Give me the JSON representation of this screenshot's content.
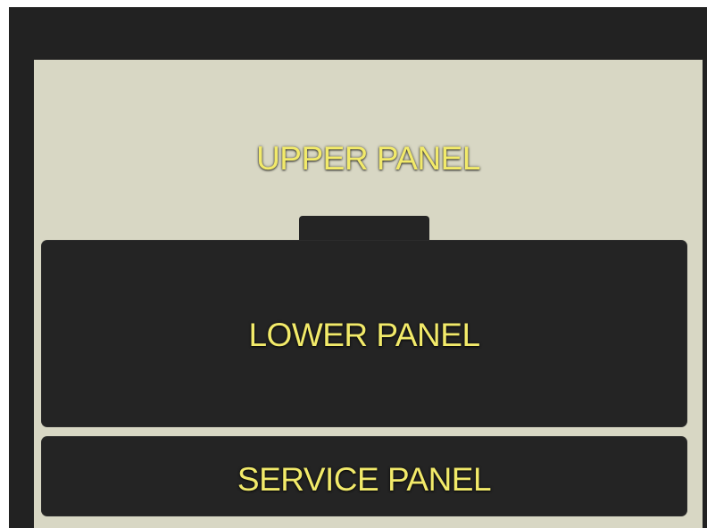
{
  "panels": {
    "upper": {
      "label": "UPPER PANEL"
    },
    "lower": {
      "label": "LOWER PANEL"
    },
    "service": {
      "label": "SERVICE PANEL"
    }
  },
  "colors": {
    "background": "#222222",
    "upper_panel": "#d8d7c4",
    "panel": "#242424",
    "label_text": "#f2ea6a"
  }
}
